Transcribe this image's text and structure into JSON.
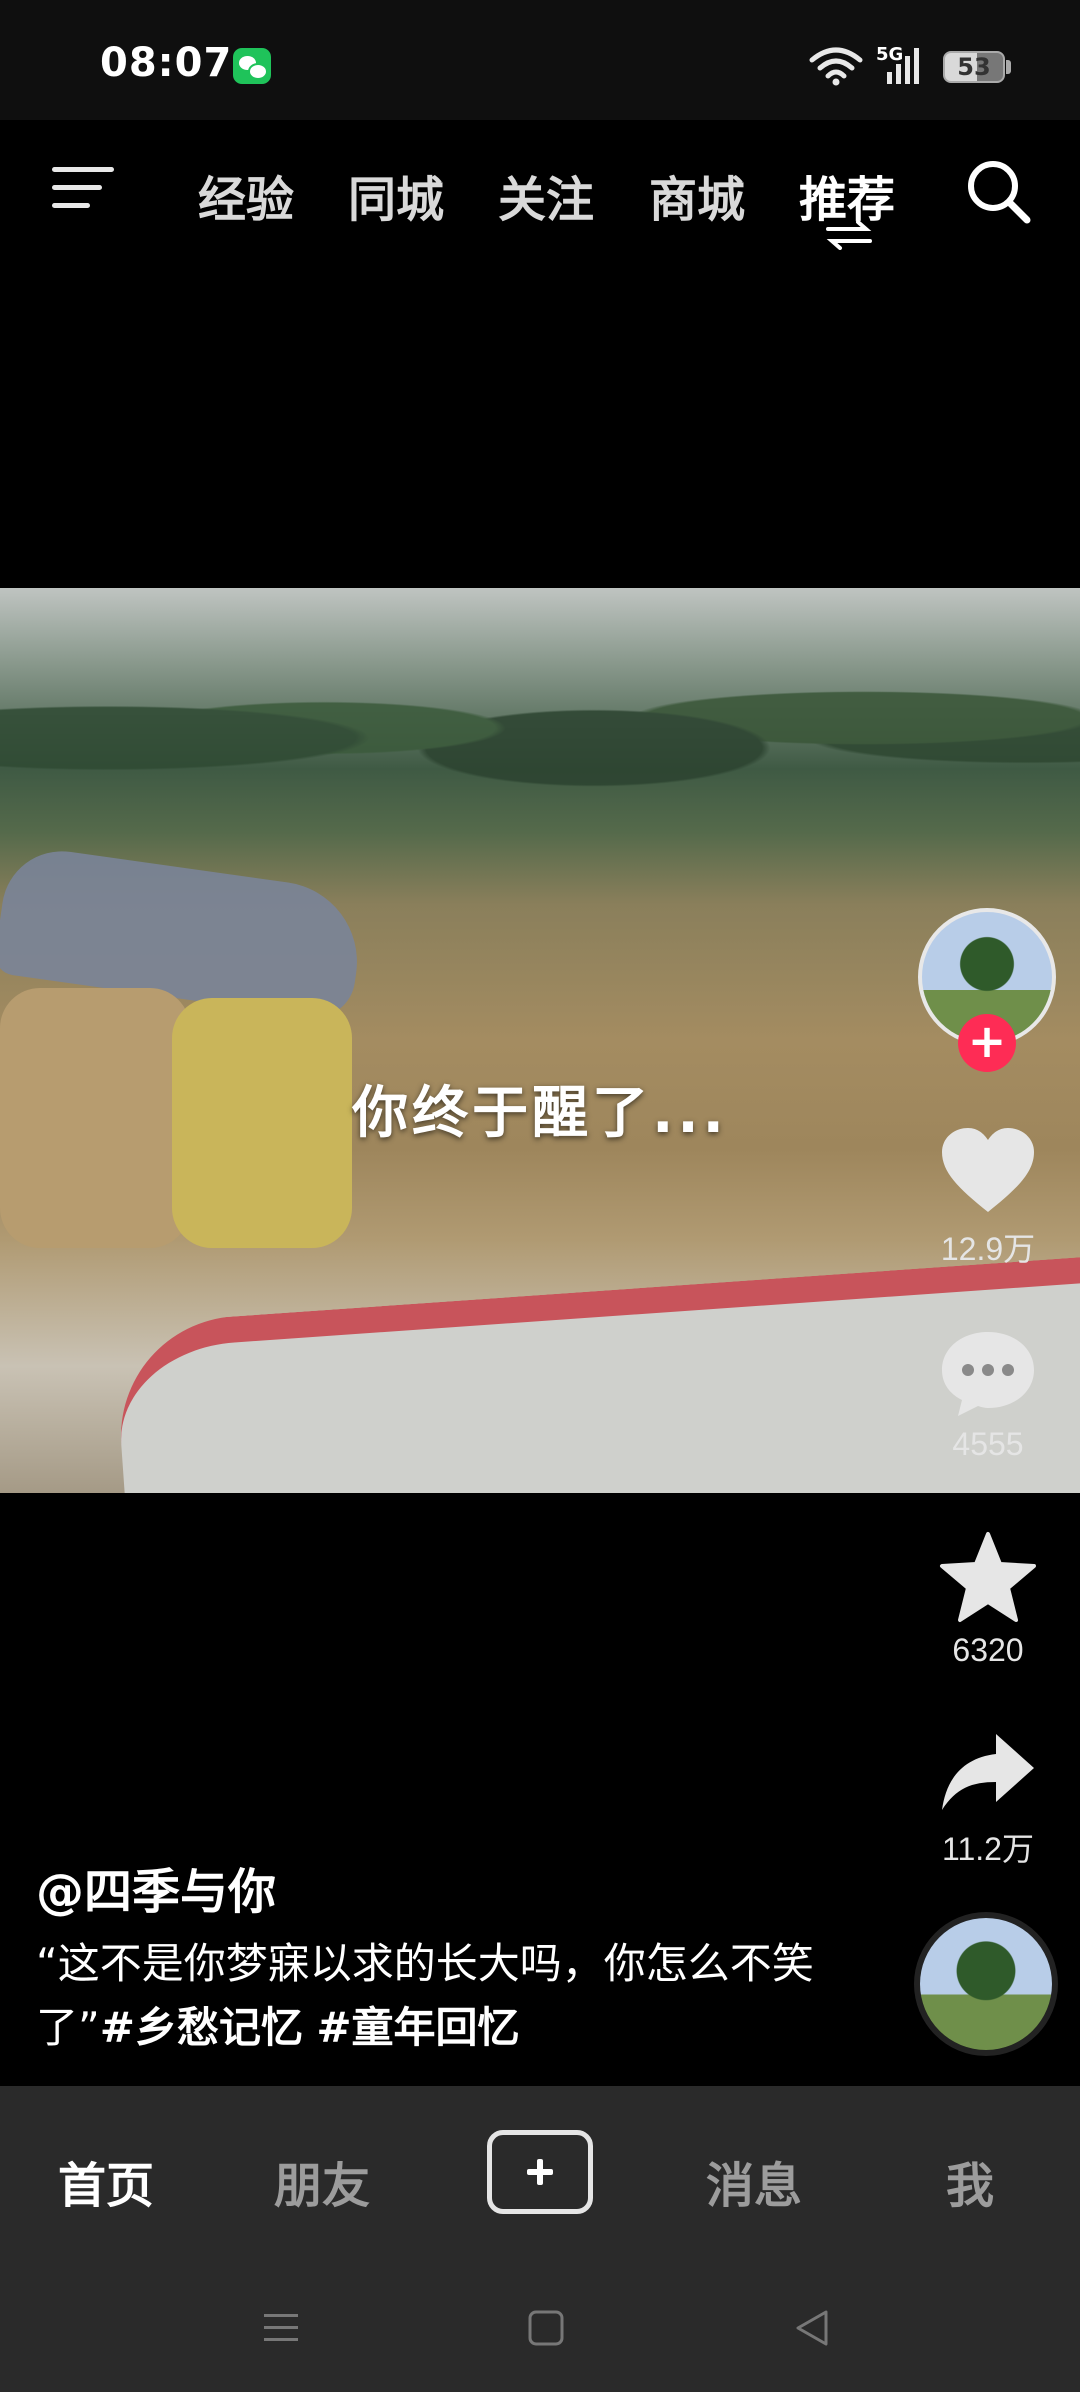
{
  "status_bar": {
    "time": "08:07",
    "network": "5G",
    "battery": "53",
    "icons": [
      "wechat-icon",
      "wifi-icon",
      "signal-icon",
      "battery-icon"
    ]
  },
  "top_nav": {
    "tabs": [
      "经验",
      "同城",
      "关注",
      "商城",
      "推荐"
    ],
    "active_tab": "推荐",
    "icons": [
      "menu-icon",
      "swap-icon",
      "search-icon"
    ]
  },
  "video": {
    "caption": "你终于醒了..."
  },
  "actions": {
    "like_count": "12.9万",
    "comment_count": "4555",
    "favorite_count": "6320",
    "share_count": "11.2万",
    "follow_symbol": "+"
  },
  "post": {
    "author": "@四季与你",
    "description_text": "“这不是你梦寐以求的长大吗，你怎么不笑了”",
    "hashtags": [
      "#乡愁记忆",
      "#童年回忆"
    ]
  },
  "bottom_nav": {
    "items": [
      "首页",
      "朋友",
      "消息",
      "我"
    ],
    "active": "首页"
  },
  "colors": {
    "accent": "#fe2c55",
    "background": "#000000",
    "nav_background": "#2a2a2a"
  }
}
